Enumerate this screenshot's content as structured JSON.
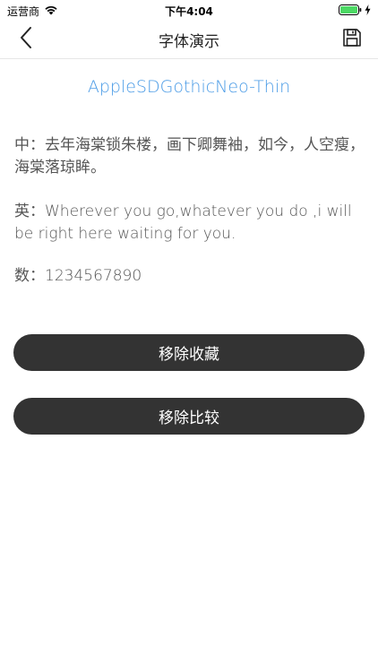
{
  "status_bar": {
    "carrier": "运营商",
    "time": "下午4:04",
    "icons": [
      "wifi-icon",
      "battery-icon",
      "charging-bolt-icon"
    ],
    "battery_color": "#4cd964"
  },
  "nav": {
    "title": "字体演示",
    "back_icon": "chevron-left-icon",
    "save_icon": "save-icon"
  },
  "font_name": "AppleSDGothicNeo-Thin",
  "samples": {
    "chinese": "中：去年海棠锁朱楼，画下卿舞袖，如今，人空瘦，海棠落琼眸。",
    "english": "英：Wherever you go,whatever you do ,i will be right here waiting for you.",
    "numbers": "数：1234567890"
  },
  "buttons": {
    "remove_favorite": "移除收藏",
    "remove_compare": "移除比较"
  },
  "colors": {
    "accent": "#4a9be6",
    "button_bg": "#333333",
    "text": "#555555"
  }
}
